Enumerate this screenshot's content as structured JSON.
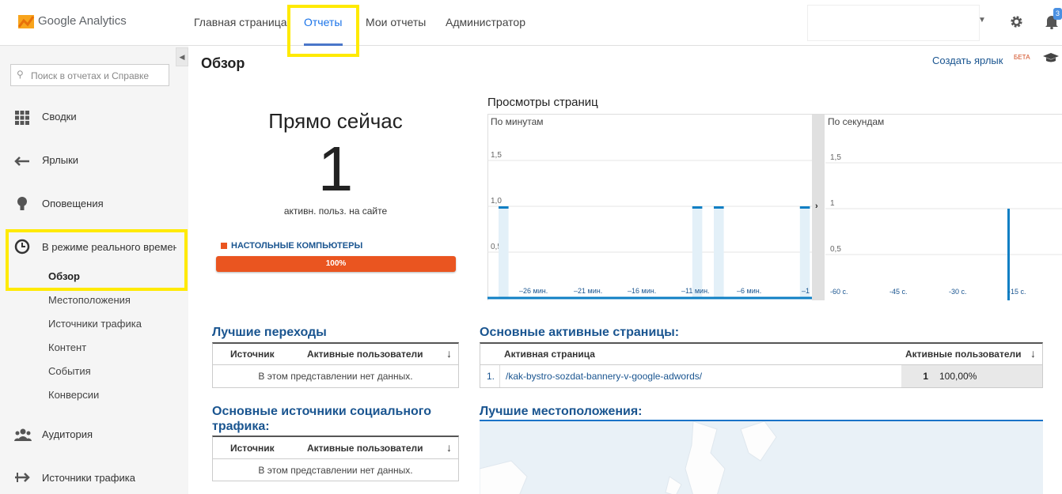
{
  "brand": {
    "name": "Google Analytics"
  },
  "top_nav": {
    "home": "Главная страница",
    "reports": "Отчеты",
    "my_reports": "Мои отчеты",
    "admin": "Администратор"
  },
  "notifications": {
    "count": "3"
  },
  "sidebar": {
    "search_placeholder": "Поиск в отчетах и Справке",
    "items": [
      {
        "label": "Сводки",
        "icon": "grid-icon"
      },
      {
        "label": "Ярлыки",
        "icon": "shortcut-arrow-icon"
      },
      {
        "label": "Оповещения",
        "icon": "lightbulb-icon"
      },
      {
        "label": "В режиме реального времени",
        "icon": "clock-icon"
      }
    ],
    "realtime_sub": [
      "Обзор",
      "Местоположения",
      "Источники трафика",
      "Контент",
      "События",
      "Конверсии"
    ],
    "audience": {
      "label": "Аудитория",
      "icon": "people-icon"
    },
    "traffic": {
      "label": "Источники трафика",
      "icon": "acquisition-icon"
    }
  },
  "page": {
    "title": "Обзор",
    "create_shortcut": "Создать ярлык",
    "beta": "БЕТА"
  },
  "right_now": {
    "title": "Прямо сейчас",
    "value": "1",
    "subtitle": "активн. польз. на сайте",
    "device_label": "НАСТОЛЬНЫЕ КОМПЬЮТЕРЫ",
    "device_percent": "100%",
    "device_color": "#ea5520"
  },
  "pageviews": {
    "title": "Просмотры страниц",
    "per_minute_label": "По минутам",
    "per_second_label": "По секундам"
  },
  "chart_data": [
    {
      "type": "bar",
      "subtitle": "По минутам",
      "yticks": [
        "0,5",
        "1,0",
        "1,5"
      ],
      "ylim": [
        0,
        2
      ],
      "xticks": [
        "–26 мин.",
        "–21 мин.",
        "–16 мин.",
        "–11 мин.",
        "–6 мин.",
        "–1"
      ],
      "x_minutes": [
        -29,
        -28,
        -27,
        -26,
        -25,
        -24,
        -23,
        -22,
        -21,
        -20,
        -19,
        -18,
        -17,
        -16,
        -15,
        -14,
        -13,
        -12,
        -11,
        -10,
        -9,
        -8,
        -7,
        -6,
        -5,
        -4,
        -3,
        -2,
        -1,
        0
      ],
      "values": [
        1,
        0,
        0,
        0,
        0,
        0,
        0,
        0,
        0,
        0,
        0,
        0,
        0,
        0,
        0,
        0,
        0,
        0,
        1,
        0,
        1,
        0,
        0,
        0,
        0,
        0,
        0,
        0,
        1,
        0
      ]
    },
    {
      "type": "bar",
      "subtitle": "По секундам",
      "yticks": [
        "0,5",
        "1",
        "1,5"
      ],
      "ylim": [
        0,
        2
      ],
      "xticks": [
        "-60 с.",
        "-45 с.",
        "-30 с.",
        "-15 с."
      ],
      "bars": [
        {
          "x_seconds": -15,
          "value": 1
        }
      ]
    }
  ],
  "top_referrals": {
    "title": "Лучшие переходы",
    "col_source": "Источник",
    "col_active": "Активные пользователи",
    "empty": "В этом представлении нет данных."
  },
  "top_social": {
    "title_line1": "Основные источники социального",
    "title_line2": "трафика:",
    "col_source": "Источник",
    "col_active": "Активные пользователи",
    "empty": "В этом представлении нет данных."
  },
  "top_pages": {
    "title": "Основные активные страницы:",
    "col_page": "Активная страница",
    "col_active": "Активные пользователи",
    "rows": [
      {
        "rank": "1.",
        "page": "/kak-bystro-sozdat-bannery-v-google-adwords/",
        "users": "1",
        "percent": "100,00%"
      }
    ]
  },
  "top_locations": {
    "title": "Лучшие местоположения:"
  }
}
